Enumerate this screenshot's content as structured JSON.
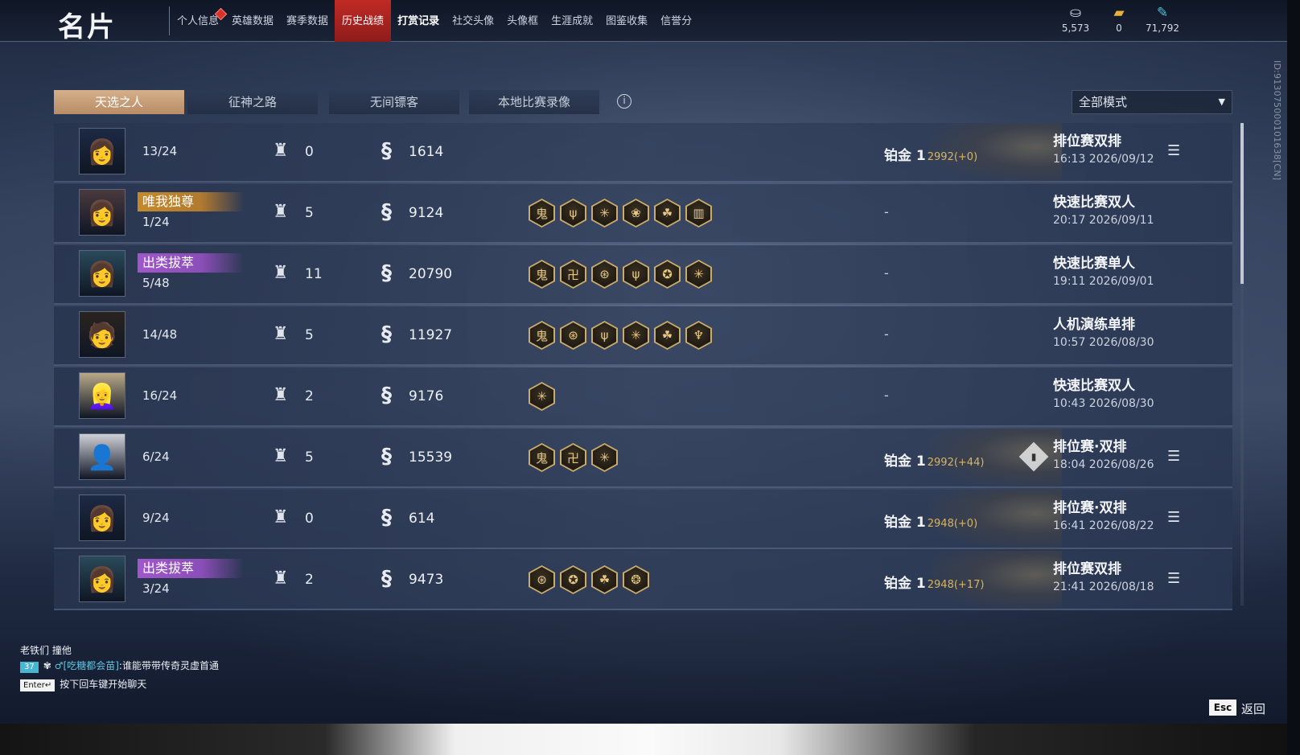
{
  "header": {
    "title": "名片",
    "nav": [
      {
        "label": "个人信息",
        "badge": true
      },
      {
        "label": "英雄数据"
      },
      {
        "label": "赛季数据"
      },
      {
        "label": "历史战绩",
        "active": true
      },
      {
        "label": "打赏记录",
        "bold": true
      },
      {
        "label": "社交头像"
      },
      {
        "label": "头像框"
      },
      {
        "label": "生涯成就"
      },
      {
        "label": "图鉴收集"
      },
      {
        "label": "信誉分"
      }
    ],
    "currencies": [
      {
        "icon": "coin-pile-icon",
        "glyph": "⛀",
        "value": "5,573",
        "color": "#d6dce6"
      },
      {
        "icon": "treasure-chest-icon",
        "glyph": "▰",
        "value": "0",
        "color": "#e8b23a"
      },
      {
        "icon": "feather-icon",
        "glyph": "✎",
        "value": "71,792",
        "color": "#4ec3d8"
      }
    ]
  },
  "tabs": [
    "天选之人",
    "征神之路",
    "无间镖客",
    "本地比赛录像"
  ],
  "active_tab": 0,
  "mode_filter": {
    "selected": "全部模式"
  },
  "vertical_id": "ID:913075000101638[CN]",
  "accent_colors": {
    "active_tab": "#c89e78",
    "nav_active": "#b5251f",
    "delta_gold": "#d9b45d"
  },
  "matches": [
    {
      "rank": "13/24",
      "title": "",
      "kills": "0",
      "score": "1614",
      "badges": [],
      "tier": "铂金 1",
      "tier_delta": "2992(+0)",
      "mode": "排位赛双排",
      "time": "16:13  2026/09/12",
      "avatar": "👩",
      "detail": true,
      "chart": false
    },
    {
      "rank": "1/24",
      "title": "唯我独尊",
      "title_style": "gold",
      "kills": "5",
      "score": "9124",
      "badges": [
        "鬼",
        "ψ",
        "✳",
        "❀",
        "☘",
        "▥"
      ],
      "tier": "",
      "tier_delta": "",
      "mode": "快速比赛双人",
      "time": "20:17  2026/09/11",
      "avatar": "👩",
      "detail": false,
      "chart": false
    },
    {
      "rank": "5/48",
      "title": "出类拔萃",
      "title_style": "purple",
      "kills": "11",
      "score": "20790",
      "badges": [
        "鬼",
        "卍",
        "⊛",
        "ψ",
        "✪",
        "✳"
      ],
      "tier": "",
      "tier_delta": "",
      "mode": "快速比赛单人",
      "time": "19:11  2026/09/01",
      "avatar": "👩",
      "detail": false,
      "chart": false
    },
    {
      "rank": "14/48",
      "title": "",
      "kills": "5",
      "score": "11927",
      "badges": [
        "鬼",
        "⊛",
        "ψ",
        "✳",
        "☘",
        "♆"
      ],
      "tier": "",
      "tier_delta": "",
      "mode": "人机演练单排",
      "time": "10:57  2026/08/30",
      "avatar": "🧑",
      "detail": false,
      "chart": false
    },
    {
      "rank": "16/24",
      "title": "",
      "kills": "2",
      "score": "9176",
      "badges": [
        "✳"
      ],
      "tier": "",
      "tier_delta": "",
      "mode": "快速比赛双人",
      "time": "10:43  2026/08/30",
      "avatar": "👱‍♀️",
      "detail": false,
      "chart": false
    },
    {
      "rank": "6/24",
      "title": "",
      "kills": "5",
      "score": "15539",
      "badges": [
        "鬼",
        "卍",
        "✳"
      ],
      "tier": "铂金 1",
      "tier_delta": "2992(+44)",
      "mode": "排位赛·双排",
      "time": "18:04  2026/08/26",
      "avatar": "👤",
      "detail": true,
      "chart": true
    },
    {
      "rank": "9/24",
      "title": "",
      "kills": "0",
      "score": "614",
      "badges": [],
      "tier": "铂金 1",
      "tier_delta": "2948(+0)",
      "mode": "排位赛·双排",
      "time": "16:41  2026/08/22",
      "avatar": "👩",
      "detail": true,
      "chart": false
    },
    {
      "rank": "3/24",
      "title": "出类拔萃",
      "title_style": "purple",
      "kills": "2",
      "score": "9473",
      "badges": [
        "⊛",
        "✪",
        "☘",
        "❂"
      ],
      "tier": "铂金 1",
      "tier_delta": "2948(+17)",
      "mode": "排位赛双排",
      "time": "21:41  2026/08/18",
      "avatar": "👩",
      "detail": true,
      "chart": false
    }
  ],
  "placeholders": {
    "no_tier": "-"
  },
  "chat": {
    "line1": "老铁们 撞他",
    "badge": "37",
    "name": "♂[吃糖都会苗]",
    "message": ":谁能带带传奇灵虚首通",
    "enter_key": "Enter↵",
    "hint": "按下回车键开始聊天"
  },
  "footer": {
    "esc_key": "Esc",
    "back_label": "返回"
  }
}
